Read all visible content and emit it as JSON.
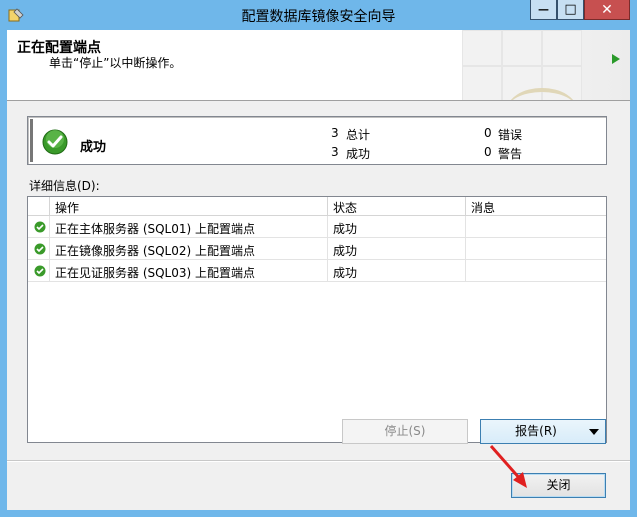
{
  "window": {
    "title": "配置数据库镜像安全向导",
    "minimize": "—",
    "maximize": "□",
    "close": "✕",
    "app_icon": "wizard-app-icon"
  },
  "header": {
    "title": "正在配置端点",
    "subtitle": "单击“停止”以中断操作。",
    "nav_icon": "forward-arrow-icon"
  },
  "summary": {
    "status_icon": "success-check-icon",
    "status": "成功",
    "total_count": "3",
    "total_label": "总计",
    "success_count": "3",
    "success_label": "成功",
    "error_count": "0",
    "error_label": "错误",
    "warning_count": "0",
    "warning_label": "警告"
  },
  "details": {
    "label": "详细信息(D):",
    "columns": [
      "操作",
      "状态",
      "消息"
    ],
    "rows": [
      {
        "action": "正在主体服务器 (SQL01) 上配置端点",
        "status": "成功",
        "message": ""
      },
      {
        "action": "正在镜像服务器 (SQL02) 上配置端点",
        "status": "成功",
        "message": ""
      },
      {
        "action": "正在见证服务器 (SQL03) 上配置端点",
        "status": "成功",
        "message": ""
      }
    ]
  },
  "buttons": {
    "stop": "停止(S)",
    "report": "报告(R)",
    "close": "关闭"
  },
  "colors": {
    "titlebar": "#6fb7ea",
    "success": "#3a9a2a",
    "annotation_arrow": "#e02020"
  }
}
